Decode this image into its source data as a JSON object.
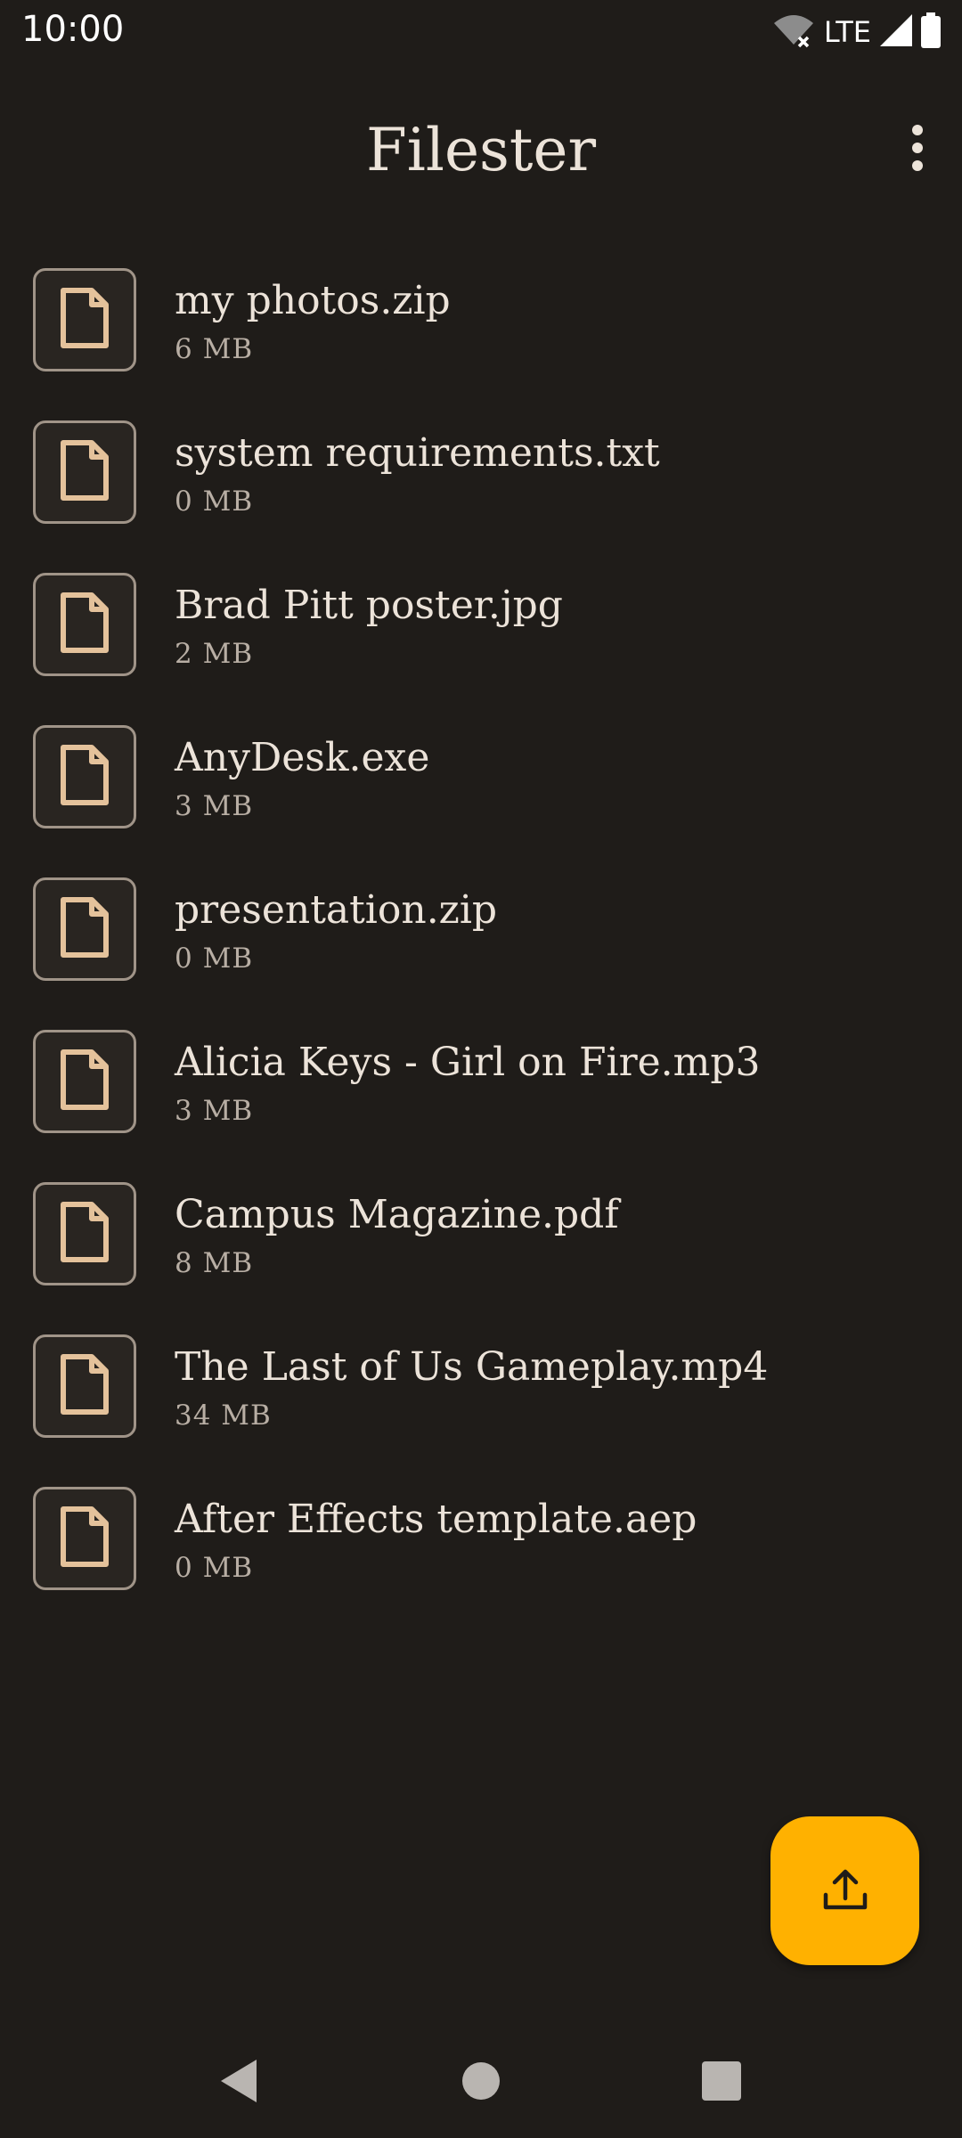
{
  "status_bar": {
    "time": "10:00",
    "network": "LTE",
    "icons": [
      "wifi-off-icon",
      "signal-icon",
      "battery-icon"
    ]
  },
  "app_bar": {
    "title": "Filester",
    "overflow_icon": "more-vert-icon"
  },
  "files": [
    {
      "name": "my photos.zip",
      "size": "6 MB"
    },
    {
      "name": "system requirements.txt",
      "size": "0 MB"
    },
    {
      "name": "Brad Pitt poster.jpg",
      "size": "2 MB"
    },
    {
      "name": "AnyDesk.exe",
      "size": "3 MB"
    },
    {
      "name": "presentation.zip",
      "size": "0 MB"
    },
    {
      "name": "Alicia Keys - Girl on Fire.mp3",
      "size": "3 MB"
    },
    {
      "name": "Campus Magazine.pdf",
      "size": "8 MB"
    },
    {
      "name": "The Last of Us Gameplay.mp4",
      "size": "34 MB"
    },
    {
      "name": "After Effects template.aep",
      "size": "0 MB"
    }
  ],
  "fab": {
    "icon": "upload-icon"
  },
  "nav_bar": {
    "icons": [
      "back-icon",
      "home-icon",
      "recents-icon"
    ]
  },
  "colors": {
    "background": "#1f1c19",
    "accent": "#ffb100",
    "file_icon": "#e4c29b",
    "text": "#ece3d9"
  }
}
